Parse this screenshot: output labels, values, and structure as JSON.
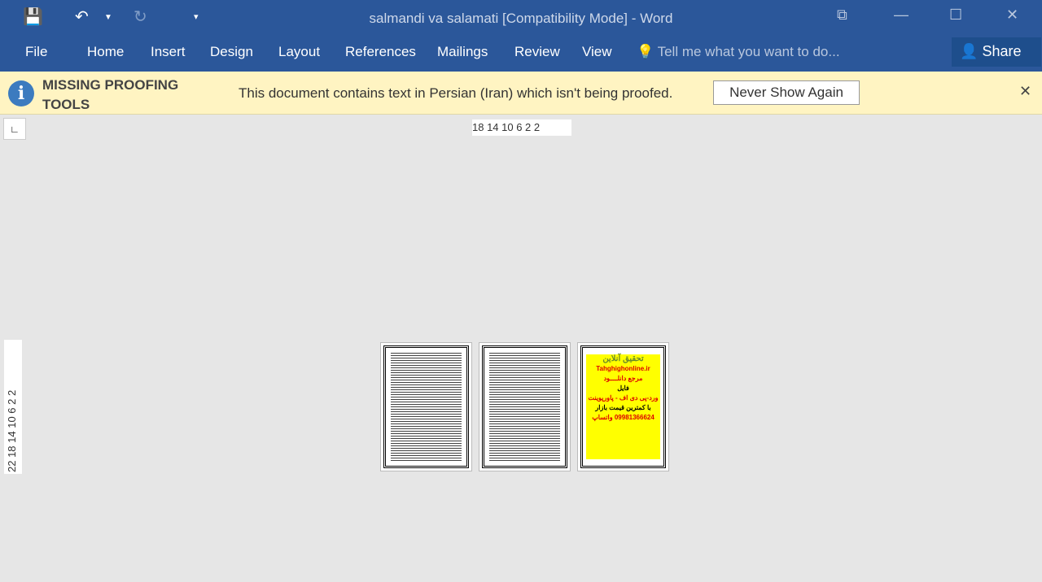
{
  "titlebar": {
    "title": "salmandi va salamati [Compatibility Mode] - Word"
  },
  "ribbon": {
    "tabs": [
      "File",
      "Home",
      "Insert",
      "Design",
      "Layout",
      "References",
      "Mailings",
      "Review",
      "View"
    ],
    "tell_me": "Tell me what you want to do...",
    "share": "Share"
  },
  "message_bar": {
    "title": "MISSING PROOFING TOOLS",
    "text": "This document contains text in Persian (Iran) which isn't being proofed.",
    "button": "Never Show Again"
  },
  "rulers": {
    "horizontal": "18 14 10  6   2   2",
    "vertical": "22 18 14 10  6   2   2"
  },
  "ad": {
    "lines": [
      "تحقیق آنلاین",
      "Tahghighonline.ir",
      "مرجع دانلــــود",
      "فایل",
      "ورد-پی دی اف - پاورپوینت",
      "با کمترین قیمت بازار",
      "09981366624 واتساپ"
    ]
  },
  "colors": {
    "ribbon": "#2b579a",
    "message_bar": "#fff4c2"
  }
}
